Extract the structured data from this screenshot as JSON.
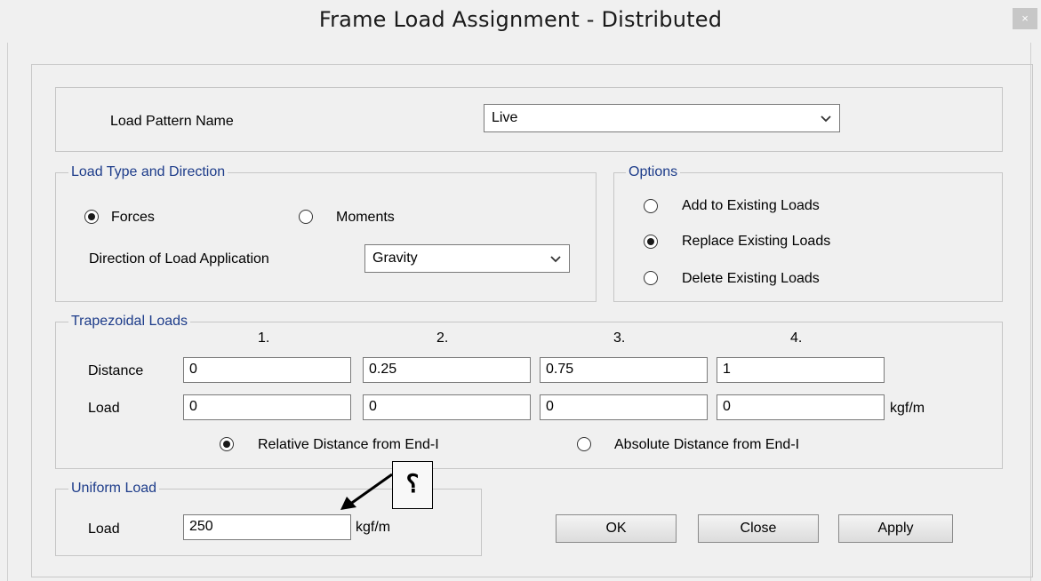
{
  "window": {
    "title": "Frame Load Assignment - Distributed",
    "close_glyph": "×"
  },
  "load_pattern": {
    "label": "Load Pattern Name",
    "value": "Live"
  },
  "load_type": {
    "legend": "Load Type and Direction",
    "forces_label": "Forces",
    "moments_label": "Moments",
    "selected": "Forces",
    "direction_label": "Direction of Load Application",
    "direction_value": "Gravity"
  },
  "options": {
    "legend": "Options",
    "add_label": "Add to Existing Loads",
    "replace_label": "Replace Existing Loads",
    "delete_label": "Delete Existing Loads",
    "selected": "Replace Existing Loads"
  },
  "trapezoidal": {
    "legend": "Trapezoidal Loads",
    "columns": [
      "1.",
      "2.",
      "3.",
      "4."
    ],
    "distance_label": "Distance",
    "distances": [
      "0",
      "0.25",
      "0.75",
      "1"
    ],
    "load_label": "Load",
    "loads": [
      "0",
      "0",
      "0",
      "0"
    ],
    "unit": "kgf/m",
    "relative_label": "Relative Distance from End-I",
    "absolute_label": "Absolute Distance from End-I",
    "selected": "Relative Distance from End-I"
  },
  "uniform": {
    "legend": "Uniform Load",
    "load_label": "Load",
    "value": "250",
    "unit": "kgf/m"
  },
  "buttons": {
    "ok": "OK",
    "close": "Close",
    "apply": "Apply"
  },
  "annotation": {
    "symbol": "؟"
  }
}
